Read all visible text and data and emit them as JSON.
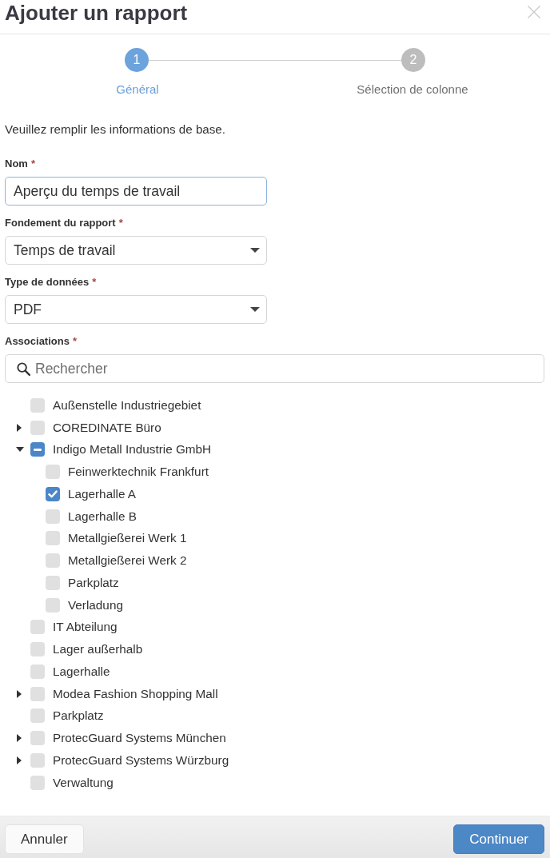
{
  "dialog": {
    "title": "Ajouter un rapport"
  },
  "steps": [
    {
      "number": "1",
      "label": "Général",
      "selected": true
    },
    {
      "number": "2",
      "label": "Sélection de colonne",
      "selected": false
    }
  ],
  "intro": "Veuillez remplir les informations de base.",
  "fields": [
    {
      "kind": "text",
      "label": "Nom",
      "required_mark": "*",
      "value": "Aperçu du temps de travail",
      "focused": true
    },
    {
      "kind": "select",
      "label": "Fondement du rapport",
      "required_mark": "*",
      "value": "Temps de travail",
      "focused": false
    },
    {
      "kind": "select",
      "label": "Type de données",
      "required_mark": "*",
      "value": "PDF",
      "focused": false
    },
    {
      "kind": "search",
      "label": "Associations",
      "required_mark": "*",
      "placeholder": "Rechercher",
      "focused": false
    }
  ],
  "tree": [
    {
      "label": "Außenstelle Industriegebiet",
      "checked": false
    },
    {
      "label": "COREDINATE Büro",
      "checked": false,
      "indeterminate": false,
      "expanded": false
    },
    {
      "label": "Indigo Metall Industrie GmbH",
      "checked": false,
      "indeterminate": true,
      "expanded": true,
      "children": [
        {
          "label": "Feinwerktechnik Frankfurt",
          "checked": false
        },
        {
          "label": "Lagerhalle A",
          "checked": true
        },
        {
          "label": "Lagerhalle B",
          "checked": false
        },
        {
          "label": "Metallgießerei Werk 1",
          "checked": false
        },
        {
          "label": "Metallgießerei Werk 2",
          "checked": false
        },
        {
          "label": "Parkplatz",
          "checked": false
        },
        {
          "label": "Verladung",
          "checked": false
        }
      ]
    },
    {
      "label": "IT Abteilung",
      "checked": false
    },
    {
      "label": "Lager außerhalb",
      "checked": false
    },
    {
      "label": "Lagerhalle",
      "checked": false
    },
    {
      "label": "Modea Fashion Shopping Mall",
      "checked": false,
      "indeterminate": false,
      "expanded": false
    },
    {
      "label": "Parkplatz",
      "checked": false
    },
    {
      "label": "ProtecGuard Systems München",
      "checked": false,
      "indeterminate": false,
      "expanded": false
    },
    {
      "label": "ProtecGuard Systems Würzburg",
      "checked": false,
      "indeterminate": false,
      "expanded": false
    },
    {
      "label": "Verwaltung",
      "checked": false
    }
  ],
  "footer": {
    "buttons": [
      {
        "label": "Annuler",
        "kind": "secondary"
      },
      {
        "label": "Continuer",
        "kind": "primary"
      }
    ]
  }
}
